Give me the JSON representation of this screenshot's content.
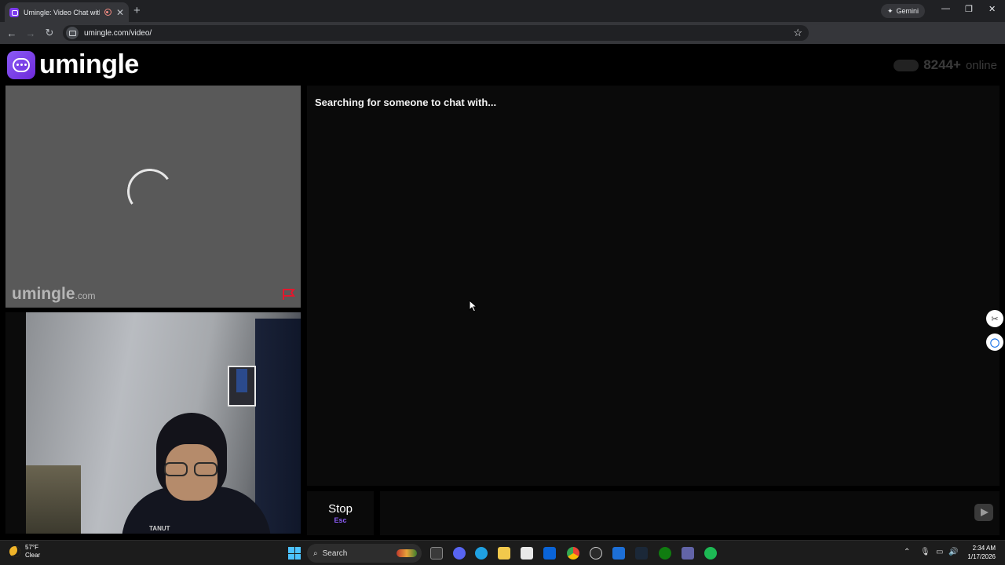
{
  "browser": {
    "tab_title": "Umingle: Video Chat with S",
    "new_tab": "+",
    "gemini_label": "Gemini",
    "url": "umingle.com/video/"
  },
  "header": {
    "logo_text": "umingle",
    "online_count": "8244+",
    "online_label": "online"
  },
  "stranger_panel": {
    "watermark_main": "umingle",
    "watermark_suffix": ".com"
  },
  "self_panel": {
    "hoodie_text": "TANUT"
  },
  "chat": {
    "status": "Searching for someone to chat with..."
  },
  "controls": {
    "stop_label": "Stop",
    "stop_shortcut": "Esc"
  },
  "taskbar": {
    "temperature": "57°F",
    "condition": "Clear",
    "search_label": "Search",
    "time": "2:34 AM",
    "date": "1/17/2026"
  },
  "colors": {
    "brand": "#7c3aed",
    "accent_shortcut": "#8b5cf6",
    "stranger_bg": "#595959",
    "flag": "#e3182d"
  }
}
